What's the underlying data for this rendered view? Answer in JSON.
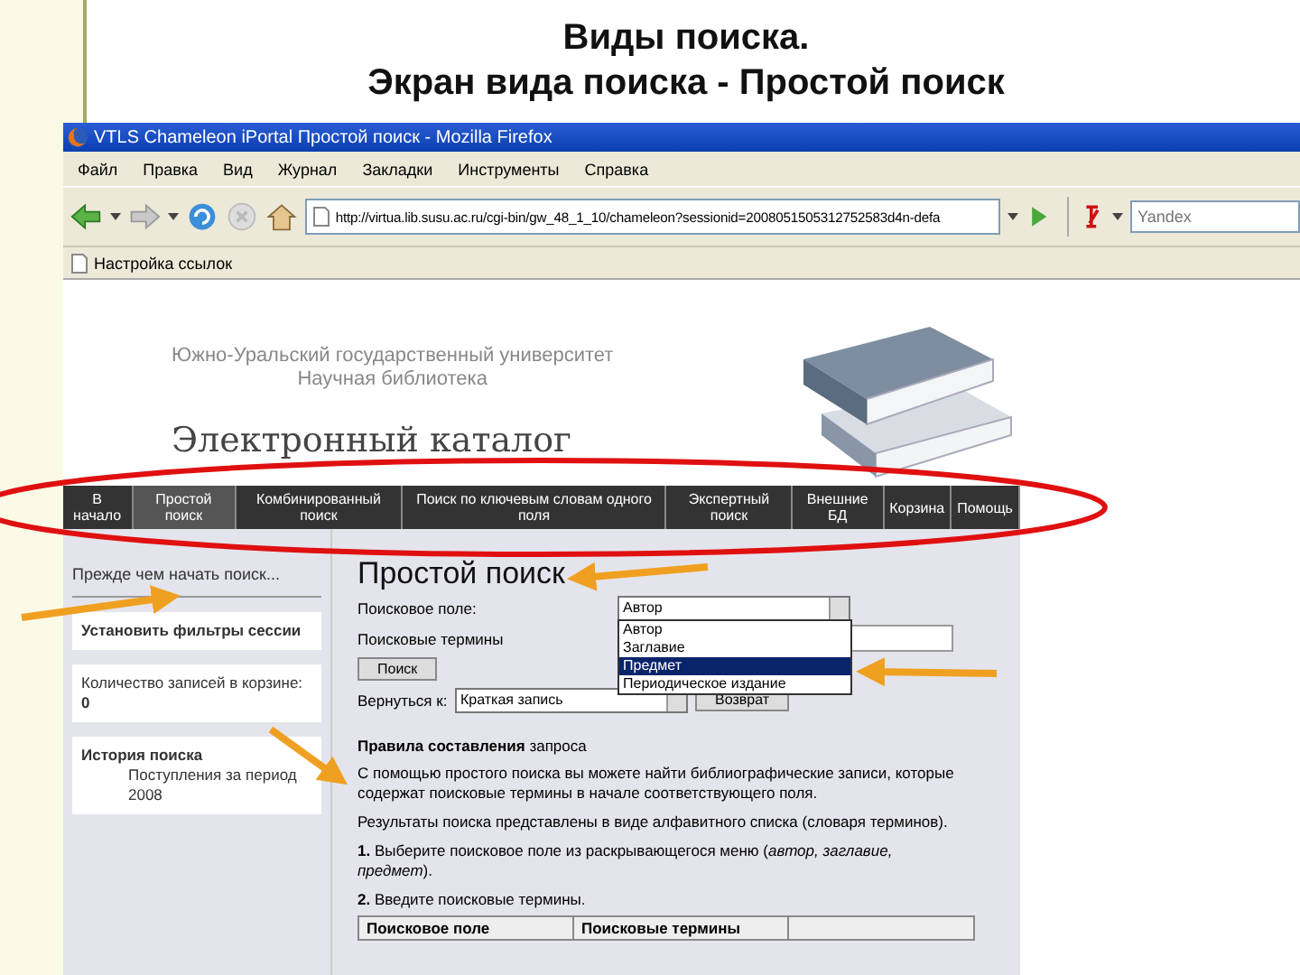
{
  "slide": {
    "title_lines": [
      "Виды поиска.",
      "Экран вида поиска - Простой поиск"
    ]
  },
  "browser": {
    "title": "VTLS Chameleon iPortal Простой поиск - Mozilla Firefox",
    "menu": [
      "Файл",
      "Правка",
      "Вид",
      "Журнал",
      "Закладки",
      "Инструменты",
      "Справка"
    ],
    "url": "http://virtua.lib.susu.ac.ru/cgi-bin/gw_48_1_10/chameleon?sessionid=2008051505312752583d4n-defa",
    "search_placeholder": "Yandex",
    "bookmarks": [
      "Настройка ссылок"
    ]
  },
  "header": {
    "university": "Южно-Уральский государственный университет",
    "library": "Научная библиотека",
    "catalog": "Электронный каталог"
  },
  "nav": [
    {
      "label": "В начало",
      "selected": false
    },
    {
      "label": "Простой поиск",
      "selected": true
    },
    {
      "label": "Комбинированный поиск",
      "selected": false
    },
    {
      "label": "Поиск по ключевым словам одного поля",
      "selected": false
    },
    {
      "label": "Экспертный поиск",
      "selected": false
    },
    {
      "label": "Внешние БД",
      "selected": false
    },
    {
      "label": "Корзина",
      "selected": false
    },
    {
      "label": "Помощь",
      "selected": false
    }
  ],
  "sidebar": [
    {
      "kind": "link",
      "text": "Прежде чем начать поиск..."
    },
    {
      "kind": "box",
      "title": "Установить фильтры сессии"
    },
    {
      "kind": "box",
      "text": "Количество записей в корзине: **0**"
    },
    {
      "kind": "box",
      "title": "История поиска",
      "text": "Поступления за период 2008"
    }
  ],
  "search": {
    "heading": "Простой поиск",
    "field_label": "Поисковое поле:",
    "field_value": "Автор",
    "options": [
      {
        "label": "Автор",
        "selected": false
      },
      {
        "label": "Заглавие",
        "selected": false
      },
      {
        "label": "Предмет",
        "selected": true
      },
      {
        "label": "Периодическое издание",
        "selected": false
      }
    ],
    "terms_label": "Поисковые термины",
    "search_button": "Поиск",
    "return_label": "Вернуться к:",
    "return_value": "Краткая запись",
    "return_button": "Возврат"
  },
  "rules": {
    "heading": "**Правила составления** запроса",
    "paragraphs": [
      "С помощью простого поиска вы можете найти библиографические записи, которые содержат поисковые термины в начале соответствующего поля.",
      "Результаты поиска представлены в виде алфавитного списка (словаря терминов).",
      "**1.** Выберите поисковое поле из раскрывающегося меню (*автор, заглавие, предмет*).",
      "**2.** Введите поисковые термины."
    ],
    "table_columns": [
      "Поисковое поле",
      "Поисковые термины"
    ]
  }
}
